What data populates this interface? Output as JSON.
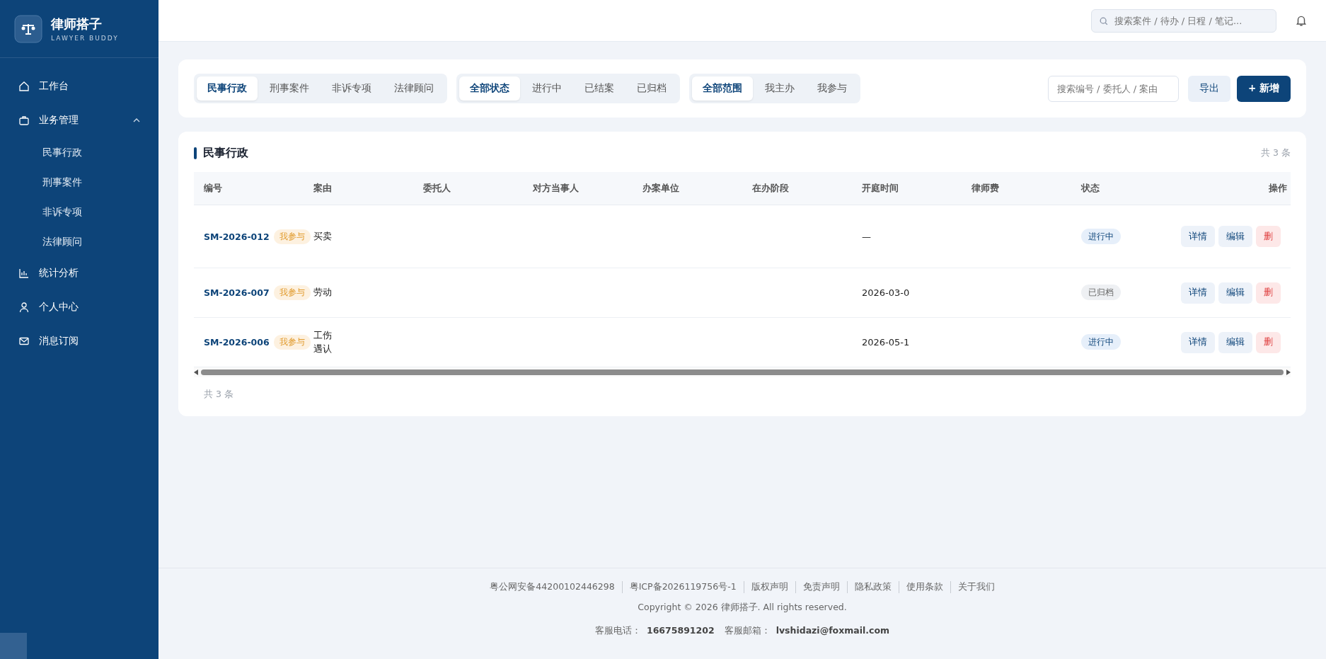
{
  "brand": {
    "name": "律师搭子",
    "subtitle": "LAWYER BUDDY"
  },
  "nav": [
    {
      "label": "工作台",
      "selected": false
    },
    {
      "label": "业务管理",
      "selected": false,
      "expanded": true,
      "children": [
        {
          "label": "民事行政",
          "selected": false
        },
        {
          "label": "刑事案件",
          "selected": false
        },
        {
          "label": "非诉专项",
          "selected": false
        },
        {
          "label": "法律顾问",
          "selected": false
        }
      ]
    },
    {
      "label": "统计分析",
      "selected": false
    },
    {
      "label": "个人中心",
      "selected": false
    },
    {
      "label": "消息订阅",
      "selected": false
    }
  ],
  "header": {
    "search_placeholder": "搜索案件 / 待办 / 日程 / 笔记..."
  },
  "filters": [
    [
      {
        "label": "民事行政",
        "selected": true
      },
      {
        "label": "刑事案件",
        "selected": false
      },
      {
        "label": "非诉专项",
        "selected": false
      },
      {
        "label": "法律顾问",
        "selected": false
      }
    ],
    [
      {
        "label": "全部状态",
        "selected": true
      },
      {
        "label": "进行中",
        "selected": false
      },
      {
        "label": "已结案",
        "selected": false
      },
      {
        "label": "已归档",
        "selected": false
      }
    ],
    [
      {
        "label": "全部范围",
        "selected": true
      },
      {
        "label": "我主办",
        "selected": false
      },
      {
        "label": "我参与",
        "selected": false
      }
    ]
  ],
  "toolbar": {
    "search_placeholder": "搜索编号 / 委托人 / 案由",
    "export": "导出",
    "add": "+ 新增"
  },
  "table": {
    "title": "民事行政",
    "count": "共 3 条",
    "columns": [
      "编号",
      "案由",
      "委托人",
      "对方当事人",
      "办案单位",
      "在办阶段",
      "开庭时间",
      "律师费",
      "状态",
      "操作"
    ],
    "rows": [
      {
        "id": "SM-2026-012",
        "tag": "我参与",
        "cause": "买卖",
        "hearing": "—",
        "status": {
          "label": "进行中",
          "kind": "active"
        },
        "actions": [
          "详情",
          "编辑",
          "删"
        ]
      },
      {
        "id": "SM-2026-007",
        "tag": "我参与",
        "cause": "劳动",
        "hearing": "2026-03-0",
        "status": {
          "label": "已归档",
          "kind": "archived"
        },
        "actions": [
          "详情",
          "编辑",
          "删"
        ]
      },
      {
        "id": "SM-2026-006",
        "tag": "我参与",
        "cause": "工伤遇认",
        "hearing": "2026-05-1",
        "status": {
          "label": "进行中",
          "kind": "active"
        },
        "actions": [
          "详情",
          "编辑",
          "删"
        ]
      }
    ],
    "footer_count": "共 3 条"
  },
  "footer": {
    "links": [
      "粤公网安备44200102446298",
      "粤ICP备2026119756号-1",
      "版权声明",
      "免责声明",
      "隐私政策",
      "使用条款",
      "关于我们"
    ],
    "copyright": "Copyright © 2026 律师搭子. All rights reserved.",
    "phone_label": "客服电话：",
    "phone": "16675891202",
    "email_label": "客服邮箱：",
    "email": "lvshidazi@foxmail.com"
  }
}
